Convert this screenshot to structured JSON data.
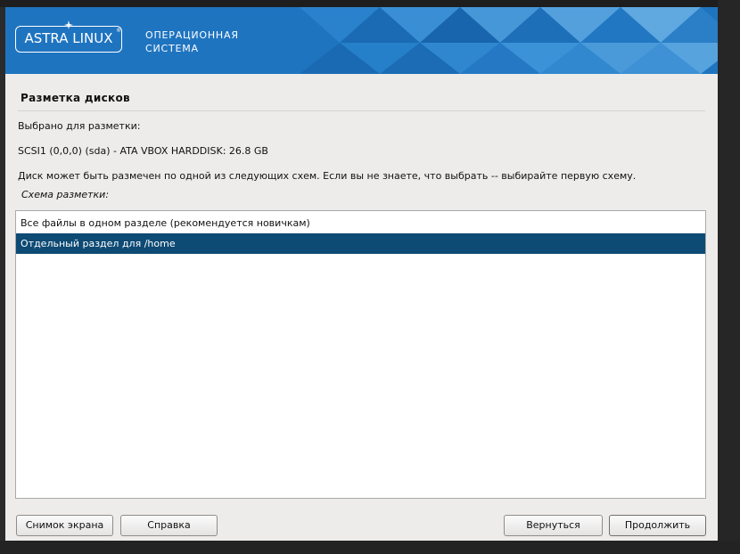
{
  "header": {
    "logo_text": "ASTRA LINUX",
    "logo_trademark": "®",
    "subtitle_line1": "ОПЕРАЦИОННАЯ",
    "subtitle_line2": "СИСТЕМА",
    "brand_color": "#1f74c0"
  },
  "page": {
    "title": "Разметка дисков",
    "selected_label": "Выбрано для разметки:",
    "disk": "SCSI1 (0,0,0) (sda) - ATA VBOX HARDDISK: 26.8 GB",
    "description": "Диск может быть размечен по одной из следующих схем. Если вы не знаете, что выбрать -- выбирайте первую схему.",
    "scheme_label": "Схема разметки:"
  },
  "schemes": {
    "options": [
      "Все файлы в одном разделе (рекомендуется новичкам)",
      "Отдельный раздел для /home"
    ],
    "selected_index": 1,
    "selection_color": "#0d4a74"
  },
  "buttons": {
    "screenshot": "Снимок экрана",
    "help": "Справка",
    "back": "Вернуться",
    "continue": "Продолжить"
  }
}
